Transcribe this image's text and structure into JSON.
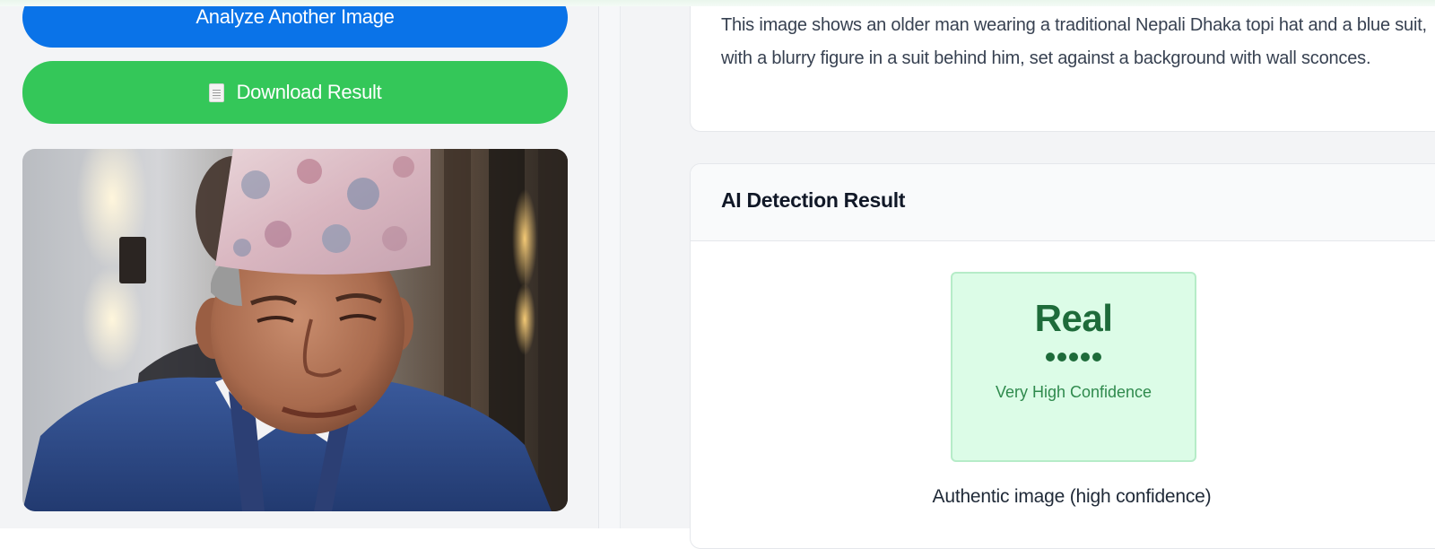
{
  "actions": {
    "analyze_label": "Analyze Another Image",
    "download_label": "Download Result",
    "download_icon": "document-icon"
  },
  "image": {
    "alt": "Uploaded photo"
  },
  "description": {
    "text": "This image shows an older man wearing a traditional Nepali Dhaka topi hat and a blue suit, with a blurry figure in a suit behind him, set against a background with wall sconces."
  },
  "detection": {
    "title": "AI Detection Result",
    "label": "Real",
    "confidence_dots": 5,
    "confidence_text": "Very High Confidence",
    "summary": "Authentic image (high confidence)"
  },
  "colors": {
    "primary_blue": "#0a73e8",
    "download_green": "#34c759",
    "real_green": "#1e6b3a",
    "real_bg": "#dcfce7"
  }
}
